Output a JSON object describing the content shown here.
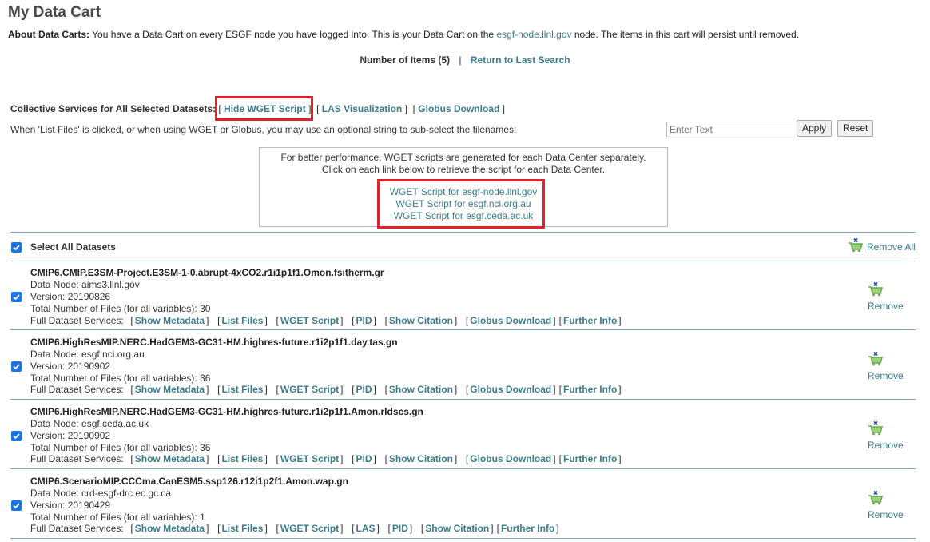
{
  "page": {
    "title": "My Data Cart",
    "about_label": "About Data Carts:",
    "about_text_1": " You have a Data Cart on every ESGF node you have logged into. This is your Data Cart on the ",
    "about_link": "esgf-node.llnl.gov",
    "about_text_2": " node. The items in this cart will persist until removed.",
    "num_items": "Number of Items (5)",
    "separator": "|",
    "return_link": "Return to Last Search"
  },
  "collective": {
    "label": "Collective Services for All Selected Datasets:",
    "hide_wget": "Hide WGET Script",
    "las": "LAS Visualization",
    "globus": "Globus Download",
    "subselect_text": "When 'List Files' is clicked, or when using WGET or Globus, you may use an optional string to sub-select the filenames:",
    "filter_placeholder": "Enter Text",
    "apply_label": "Apply",
    "reset_label": "Reset"
  },
  "wget_box": {
    "info_1": "For better performance, WGET scripts are generated for each Data Center separately.",
    "info_2": "Click on each link below to retrieve the script for each Data Center.",
    "links": [
      "WGET Script for esgf-node.llnl.gov",
      "WGET Script for esgf.nci.org.au",
      "WGET Script for esgf.ceda.ac.uk"
    ]
  },
  "select_all": {
    "label": "Select All Datasets",
    "checked": true,
    "remove_all": "Remove All"
  },
  "datasets": [
    {
      "title": "CMIP6.CMIP.E3SM-Project.E3SM-1-0.abrupt-4xCO2.r1i1p1f1.Omon.fsitherm.gr",
      "data_node": "Data Node: aims3.llnl.gov",
      "version": "Version: 20190826",
      "files": "Total Number of Files (for all variables): 30",
      "services_label": "Full Dataset Services:",
      "services": [
        "Show Metadata",
        "List Files",
        "WGET Script",
        "PID",
        "Show Citation",
        "Globus Download",
        "Further Info"
      ],
      "remove": "Remove",
      "checked": true
    },
    {
      "title": "CMIP6.HighResMIP.NERC.HadGEM3-GC31-HM.highres-future.r1i2p1f1.day.tas.gn",
      "data_node": "Data Node: esgf.nci.org.au",
      "version": "Version: 20190902",
      "files": "Total Number of Files (for all variables): 36",
      "services_label": "Full Dataset Services:",
      "services": [
        "Show Metadata",
        "List Files",
        "WGET Script",
        "PID",
        "Show Citation",
        "Globus Download",
        "Further Info"
      ],
      "remove": "Remove",
      "checked": true
    },
    {
      "title": "CMIP6.HighResMIP.NERC.HadGEM3-GC31-HM.highres-future.r1i2p1f1.Amon.rldscs.gn",
      "data_node": "Data Node: esgf.ceda.ac.uk",
      "version": "Version: 20190902",
      "files": "Total Number of Files (for all variables): 36",
      "services_label": "Full Dataset Services:",
      "services": [
        "Show Metadata",
        "List Files",
        "WGET Script",
        "PID",
        "Show Citation",
        "Globus Download",
        "Further Info"
      ],
      "remove": "Remove",
      "checked": true
    },
    {
      "title": "CMIP6.ScenarioMIP.CCCma.CanESM5.ssp126.r12i1p2f1.Amon.wap.gn",
      "data_node": "Data Node: crd-esgf-drc.ec.gc.ca",
      "version": "Version: 20190429",
      "files": "Total Number of Files (for all variables): 1",
      "services_label": "Full Dataset Services:",
      "services": [
        "Show Metadata",
        "List Files",
        "WGET Script",
        "LAS",
        "PID",
        "Show Citation",
        "Further Info"
      ],
      "remove": "Remove",
      "checked": true
    }
  ],
  "colors": {
    "link": "#3a7b8c",
    "highlight": "#e0202a",
    "checkbox": "#1a73e8",
    "divider": "#7fa9b5"
  }
}
